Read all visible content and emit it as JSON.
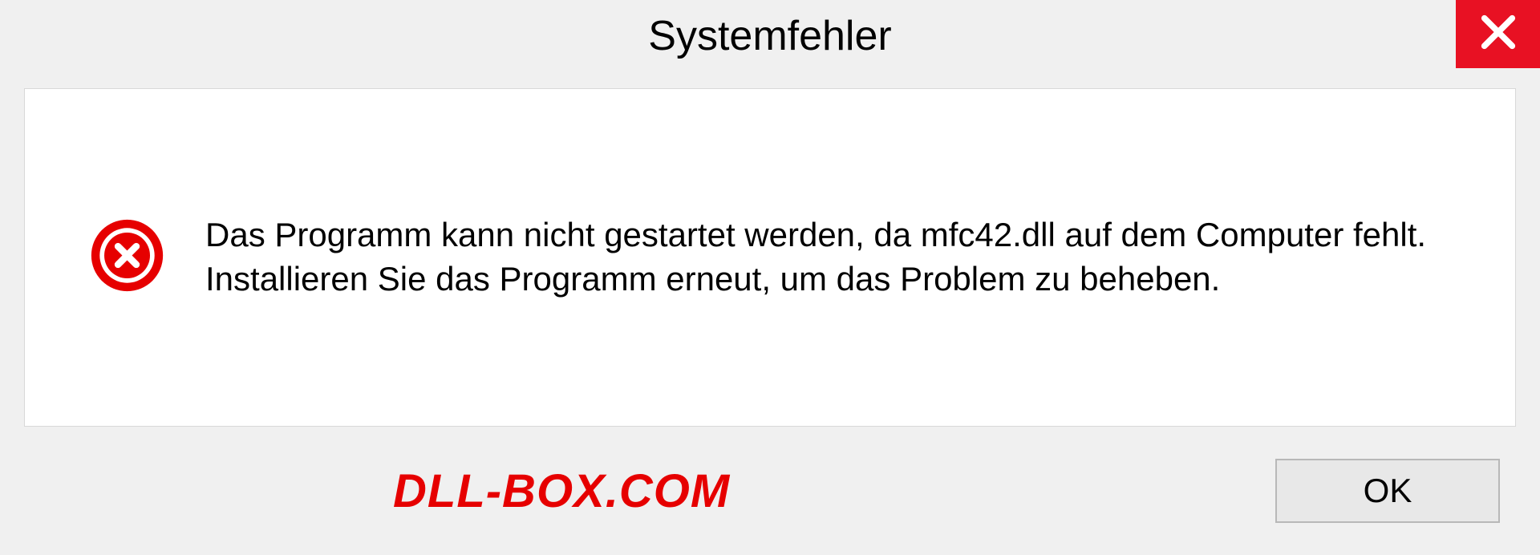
{
  "dialog": {
    "title": "Systemfehler",
    "message": "Das Programm kann nicht gestartet werden, da mfc42.dll auf dem Computer fehlt. Installieren Sie das Programm erneut, um das Problem zu beheben.",
    "ok_label": "OK"
  },
  "watermark": "DLL-BOX.COM"
}
